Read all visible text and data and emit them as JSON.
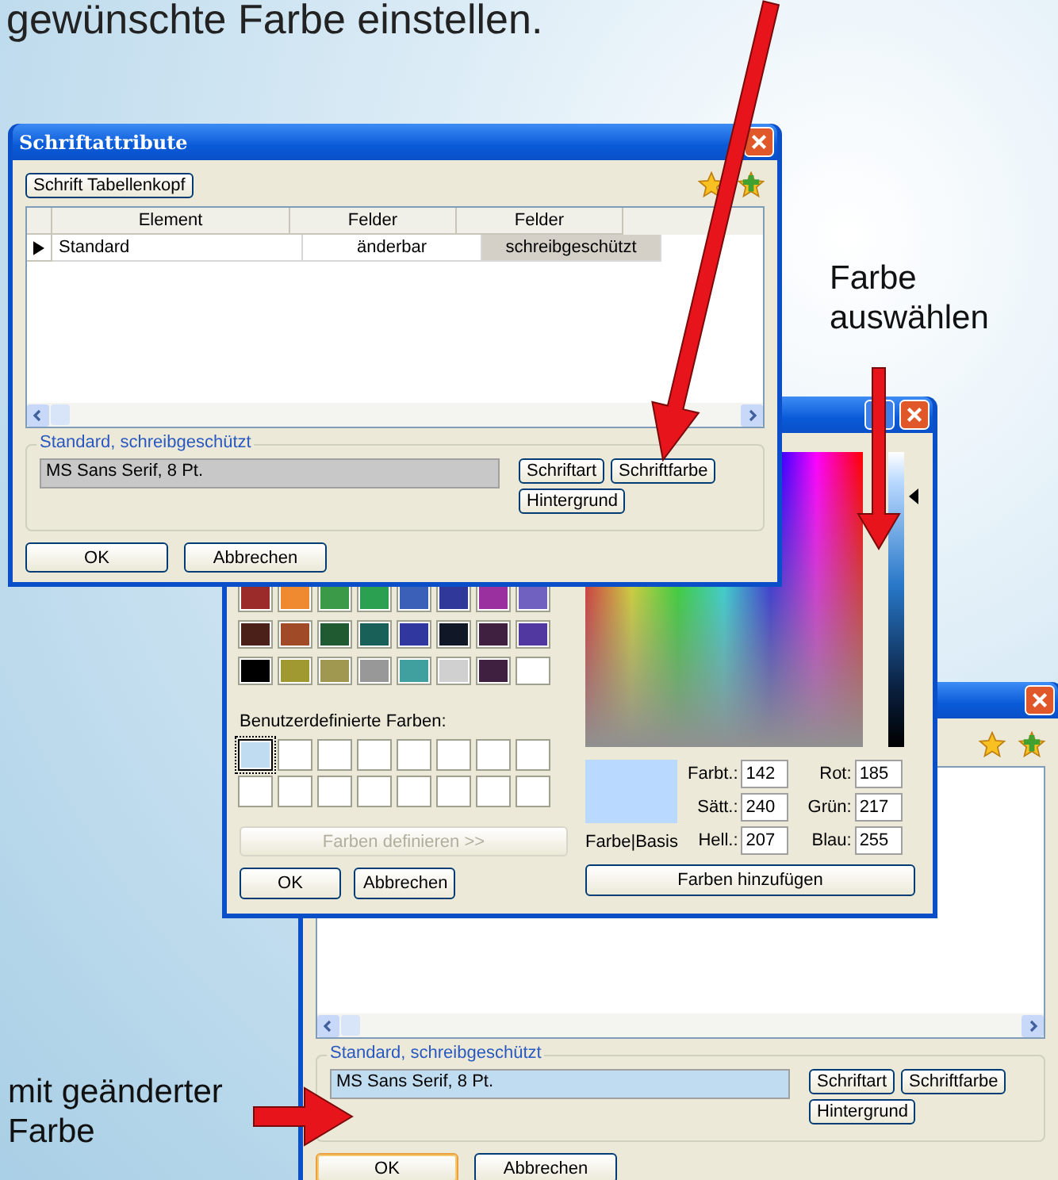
{
  "caption": "gewünschte Farbe einstellen.",
  "annotations": [
    {
      "text": "Farbe auswählen"
    },
    {
      "text": "mit geänderter Farbe"
    }
  ],
  "font_window": {
    "title": "Schriftattribute",
    "toolbar_button": "Schrift Tabellenkopf",
    "table": {
      "columns": [
        "Element",
        "Felder",
        "Felder"
      ],
      "rows": [
        {
          "selected": true,
          "cells": [
            {
              "text": "Standard",
              "selected": false
            },
            {
              "text": "änderbar",
              "selected": false
            },
            {
              "text": "schreibgeschützt",
              "selected": true
            }
          ]
        }
      ]
    },
    "group": {
      "label": "Standard, schreibgeschützt",
      "value": "MS Sans Serif, 8 Pt.",
      "color": "#c8c8c8",
      "buttons": [
        "Schriftart",
        "Schriftfarbe",
        "Hintergrund"
      ]
    },
    "buttons": [
      {
        "label": "OK",
        "focused": false
      },
      {
        "label": "Abbrechen",
        "focused": false
      }
    ]
  },
  "color_dialog": {
    "basic_colors": [
      {
        "color": "#9b2a2a"
      },
      {
        "color": "#f08a30"
      },
      {
        "color": "#3a9a48"
      },
      {
        "color": "#2aa050"
      },
      {
        "color": "#3a60b8"
      },
      {
        "color": "#30389a"
      },
      {
        "color": "#9a30a0"
      },
      {
        "color": "#7060c0"
      },
      {
        "color": "#4a2018"
      },
      {
        "color": "#a04a28"
      },
      {
        "color": "#205a30"
      },
      {
        "color": "#186058"
      },
      {
        "color": "#3038a0"
      },
      {
        "color": "#101828"
      },
      {
        "color": "#402040"
      },
      {
        "color": "#5038a0"
      },
      {
        "color": "#000000"
      },
      {
        "color": "#a09830"
      },
      {
        "color": "#a09850"
      },
      {
        "color": "#989898"
      },
      {
        "color": "#40a0a0"
      },
      {
        "color": "#d0d0d0"
      },
      {
        "color": "#402040"
      },
      {
        "color": "#ffffff"
      }
    ],
    "custom_label": "Benutzerdefinierte Farben:",
    "custom_colors": [
      {
        "color": "#bfdcf0",
        "selected": true
      },
      {
        "color": "#ffffff",
        "selected": false
      },
      {
        "color": "#ffffff",
        "selected": false
      },
      {
        "color": "#ffffff",
        "selected": false
      },
      {
        "color": "#ffffff",
        "selected": false
      },
      {
        "color": "#ffffff",
        "selected": false
      },
      {
        "color": "#ffffff",
        "selected": false
      },
      {
        "color": "#ffffff",
        "selected": false
      },
      {
        "color": "#ffffff",
        "selected": false
      },
      {
        "color": "#ffffff",
        "selected": false
      },
      {
        "color": "#ffffff",
        "selected": false
      },
      {
        "color": "#ffffff",
        "selected": false
      },
      {
        "color": "#ffffff",
        "selected": false
      },
      {
        "color": "#ffffff",
        "selected": false
      },
      {
        "color": "#ffffff",
        "selected": false
      },
      {
        "color": "#ffffff",
        "selected": false
      }
    ],
    "define_button": {
      "label": "Farben definieren >>",
      "disabled": true
    },
    "buttons": [
      "OK",
      "Abbrechen"
    ],
    "luminosity": {
      "level": 0.85
    },
    "preview": {
      "color": "#b9d9ff",
      "label": "Farbe|Basis"
    },
    "fields": [
      {
        "label": "Farbt.:",
        "value": "142"
      },
      {
        "label": "Rot:",
        "value": "185"
      },
      {
        "label": "Sätt.:",
        "value": "240"
      },
      {
        "label": "Grün:",
        "value": "217"
      },
      {
        "label": "Hell.:",
        "value": "207"
      },
      {
        "label": "Blau:",
        "value": "255"
      }
    ],
    "add_button": "Farben hinzufügen"
  },
  "result_window": {
    "group": {
      "label": "Standard, schreibgeschützt",
      "value": "MS Sans Serif, 8 Pt.",
      "color": "#c0dcf0",
      "buttons": [
        "Schriftart",
        "Schriftfarbe",
        "Hintergrund"
      ]
    },
    "buttons": [
      {
        "label": "OK",
        "focused": true
      },
      {
        "label": "Abbrechen",
        "focused": false
      }
    ]
  }
}
